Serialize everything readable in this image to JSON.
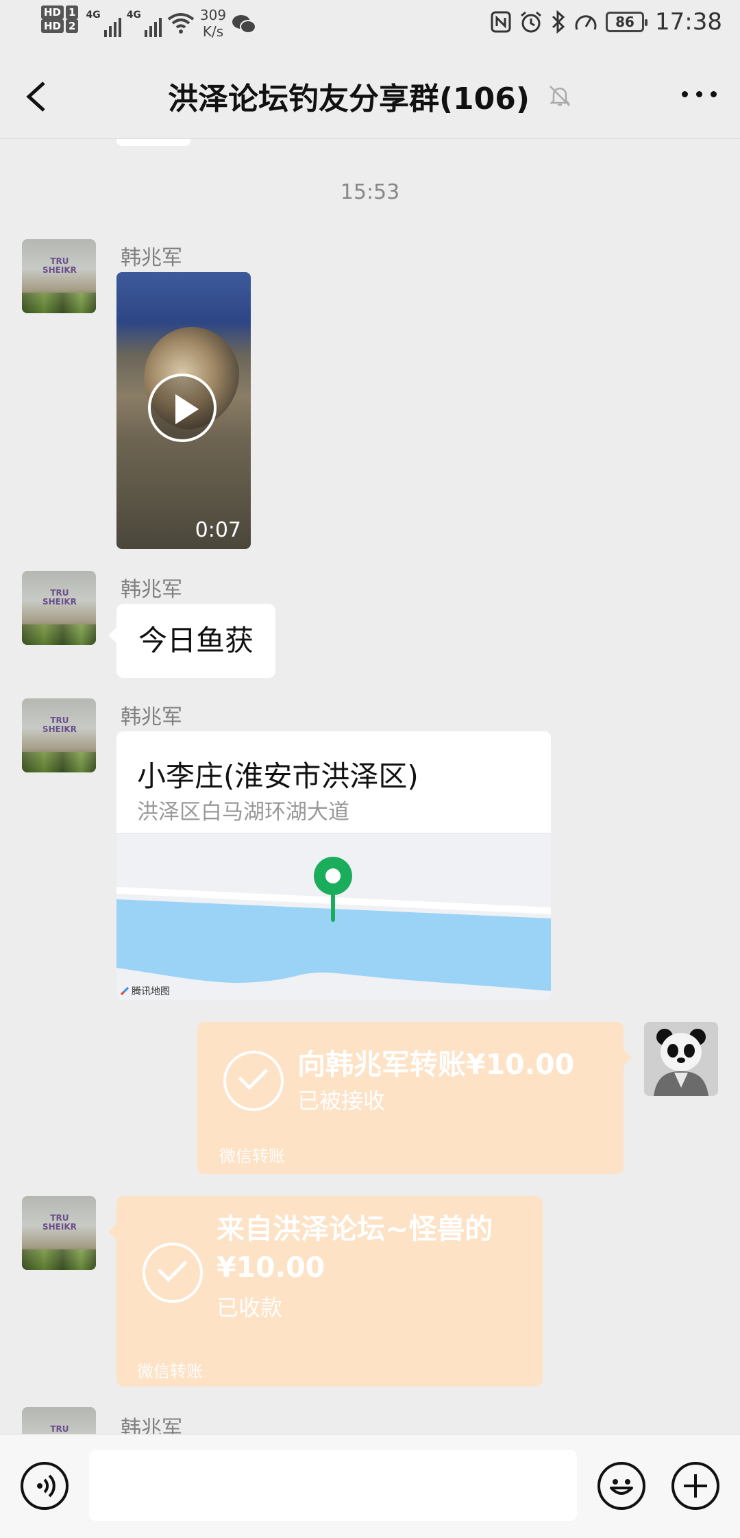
{
  "status_bar": {
    "hd1": "HD",
    "hd1_num": "1",
    "hd2": "HD",
    "hd2_num": "2",
    "net1": "4G",
    "net2": "4G",
    "speed_value": "309",
    "speed_unit": "K/s",
    "battery": "86",
    "time": "17:38",
    "icons": [
      "nfc-icon",
      "alarm-icon",
      "bluetooth-icon",
      "speedometer-icon",
      "battery-icon"
    ]
  },
  "header": {
    "title": "洪泽论坛钓友分享群(106)",
    "muted": true
  },
  "chat": {
    "timestamp": "15:53",
    "messages": [
      {
        "type": "video",
        "sender": "韩兆军",
        "duration": "0:07"
      },
      {
        "type": "text",
        "sender": "韩兆军",
        "text": "今日鱼获"
      },
      {
        "type": "location",
        "sender": "韩兆军",
        "title": "小李庄(淮安市洪泽区)",
        "address": "洪泽区白马湖环湖大道",
        "map_brand": "腾讯地图"
      },
      {
        "type": "transfer",
        "direction": "outgoing",
        "title": "向韩兆军转账¥10.00",
        "status": "已被接收",
        "footer": "微信转账"
      },
      {
        "type": "transfer",
        "direction": "incoming",
        "title_line1": "来自洪泽论坛~怪兽的",
        "title_line2": "¥10.00",
        "status": "已收款",
        "footer": "微信转账"
      },
      {
        "type": "partial",
        "sender": "韩兆军"
      }
    ]
  },
  "input_bar": {
    "value": "",
    "placeholder": ""
  },
  "colors": {
    "background": "#ededed",
    "transfer_bg": "#fde2c5",
    "map_pin": "#1aad5b",
    "water": "#9bd3f7"
  }
}
